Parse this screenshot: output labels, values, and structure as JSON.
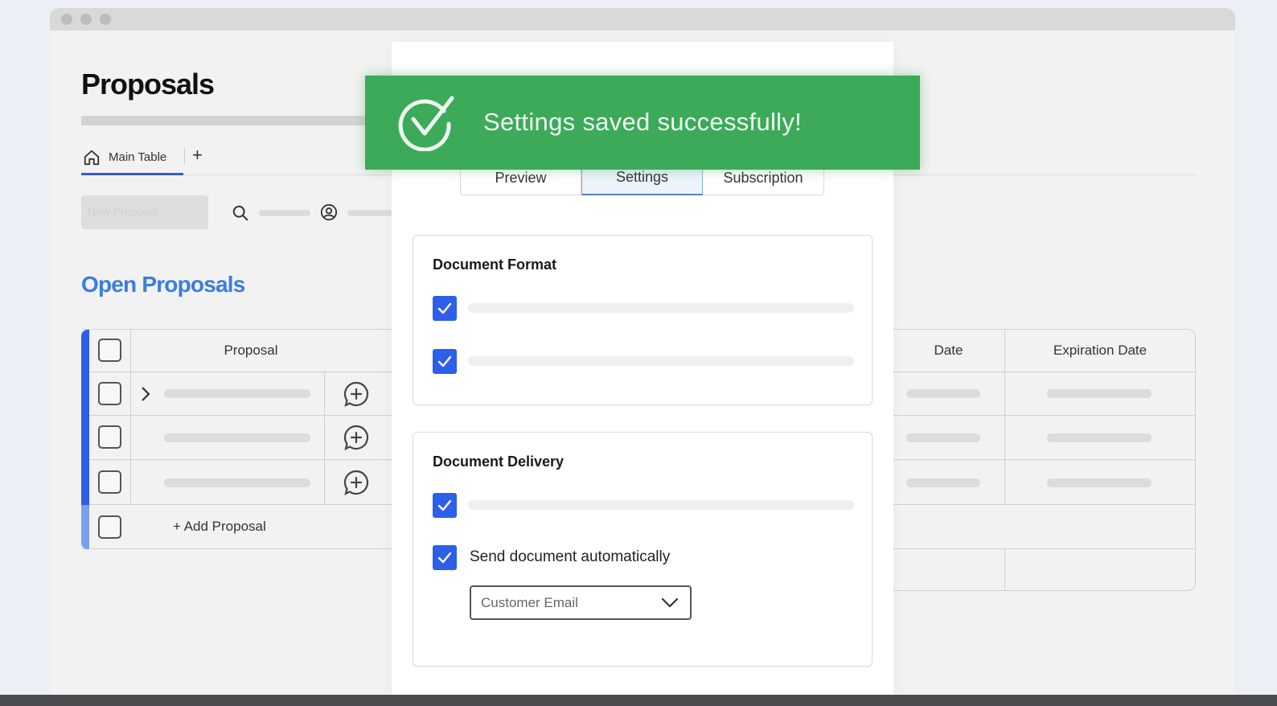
{
  "window": {
    "traffic_lights": [
      "close",
      "minimize",
      "maximize"
    ]
  },
  "board": {
    "title": "Proposals",
    "views": [
      {
        "label": "Main Table",
        "icon": "home-icon",
        "active": true
      }
    ],
    "add_view_label": "+",
    "toolbar": {
      "new_item_label": "New Proposal",
      "search_icon": "search-icon",
      "person_icon": "person-icon"
    },
    "group": {
      "title": "Open Proposals",
      "color": "#3b7ddd",
      "bar_color": "#2e5fe8",
      "columns": [
        "Proposal",
        "Date",
        "Expiration Date"
      ],
      "row_count": 3,
      "add_row_label": "+ Add Proposal"
    }
  },
  "panel": {
    "tabs": [
      {
        "label": "Preview",
        "active": false
      },
      {
        "label": "Settings",
        "active": true
      },
      {
        "label": "Subscription",
        "active": false
      }
    ],
    "sections": [
      {
        "title": "Document Format",
        "options": [
          {
            "checked": true,
            "label": ""
          },
          {
            "checked": true,
            "label": ""
          }
        ]
      },
      {
        "title": "Document Delivery",
        "options": [
          {
            "checked": true,
            "label": ""
          },
          {
            "checked": true,
            "label": "Send document automatically"
          }
        ],
        "select": {
          "value": "Customer Email"
        }
      }
    ]
  },
  "toast": {
    "message": "Settings saved successfully!",
    "icon": "check-circle-icon",
    "color": "#3daa5a"
  },
  "colors": {
    "checkbox_checked": "#2e5fe8",
    "tab_active_bg": "#edf3fb"
  }
}
